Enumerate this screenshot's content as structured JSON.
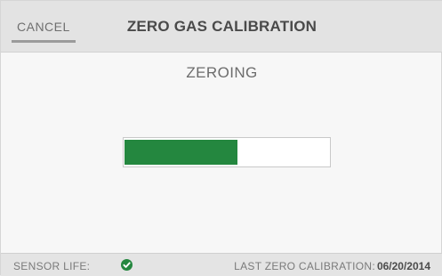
{
  "header": {
    "cancel_label": "CANCEL",
    "title": "ZERO GAS CALIBRATION"
  },
  "main": {
    "status": "ZEROING",
    "progress": {
      "fraction": 0.55,
      "fill_color": "#24873f"
    }
  },
  "footer": {
    "sensor_life_label": "SENSOR LIFE:",
    "sensor_life_icon": "check-circle-icon",
    "sensor_life_color": "#24873f",
    "last_calibration_label": "LAST ZERO CALIBRATION:",
    "last_calibration_date": "06/20/2014"
  }
}
